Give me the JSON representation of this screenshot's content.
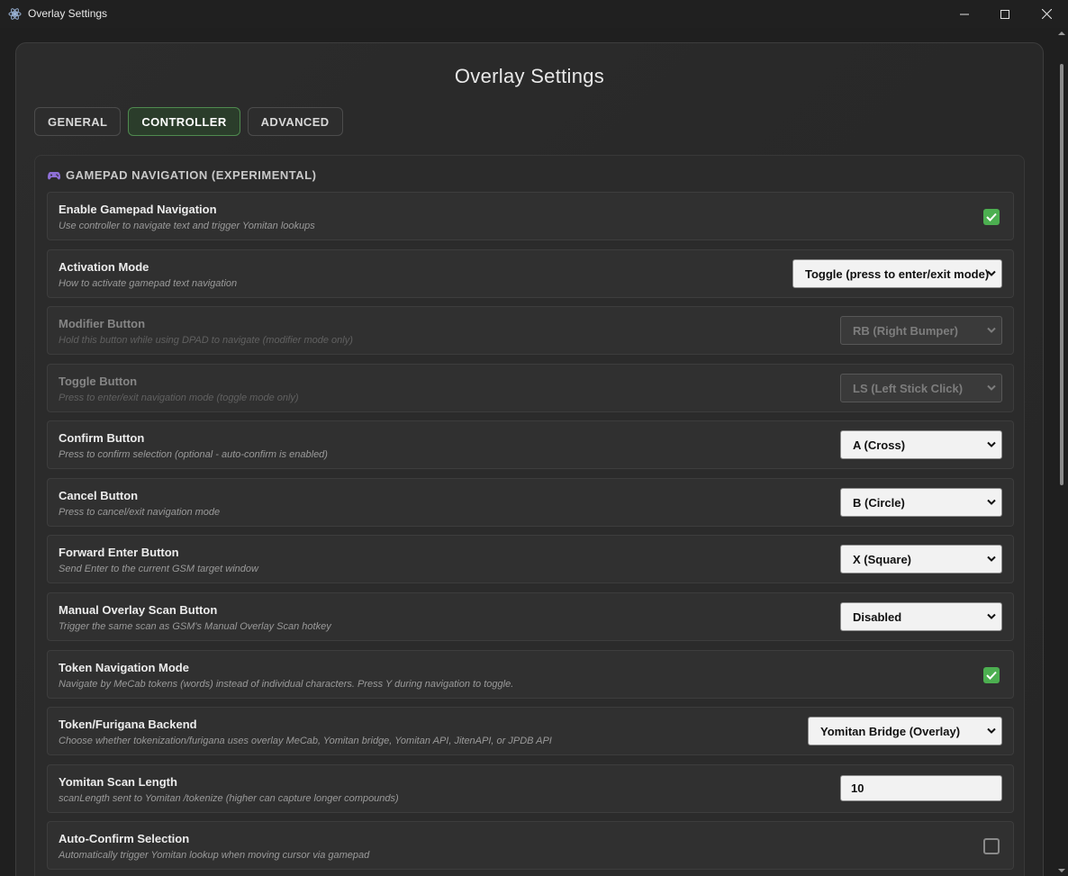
{
  "window": {
    "title": "Overlay Settings"
  },
  "page": {
    "title": "Overlay Settings"
  },
  "tabs": [
    {
      "label": "GENERAL",
      "active": false
    },
    {
      "label": "CONTROLLER",
      "active": true
    },
    {
      "label": "ADVANCED",
      "active": false
    }
  ],
  "section": {
    "icon": "gamepad-icon",
    "title": "GAMEPAD NAVIGATION (EXPERIMENTAL)"
  },
  "settings": {
    "enable_gamepad": {
      "label": "Enable Gamepad Navigation",
      "desc": "Use controller to navigate text and trigger Yomitan lookups",
      "checked": true
    },
    "activation_mode": {
      "label": "Activation Mode",
      "desc": "How to activate gamepad text navigation",
      "value": "Toggle (press to enter/exit mode)"
    },
    "modifier_button": {
      "label": "Modifier Button",
      "desc": "Hold this button while using DPAD to navigate (modifier mode only)",
      "value": "RB (Right Bumper)",
      "disabled": true
    },
    "toggle_button": {
      "label": "Toggle Button",
      "desc": "Press to enter/exit navigation mode (toggle mode only)",
      "value": "LS (Left Stick Click)",
      "disabled": true
    },
    "confirm_button": {
      "label": "Confirm Button",
      "desc": "Press to confirm selection (optional - auto-confirm is enabled)",
      "value": "A (Cross)"
    },
    "cancel_button": {
      "label": "Cancel Button",
      "desc": "Press to cancel/exit navigation mode",
      "value": "B (Circle)"
    },
    "forward_enter": {
      "label": "Forward Enter Button",
      "desc": "Send Enter to the current GSM target window",
      "value": "X (Square)"
    },
    "manual_scan": {
      "label": "Manual Overlay Scan Button",
      "desc": "Trigger the same scan as GSM's Manual Overlay Scan hotkey",
      "value": "Disabled"
    },
    "token_nav": {
      "label": "Token Navigation Mode",
      "desc": "Navigate by MeCab tokens (words) instead of individual characters. Press Y during navigation to toggle.",
      "checked": true
    },
    "token_backend": {
      "label": "Token/Furigana Backend",
      "desc": "Choose whether tokenization/furigana uses overlay MeCab, Yomitan bridge, Yomitan API, JitenAPI, or JPDB API",
      "value": "Yomitan Bridge (Overlay)"
    },
    "scan_length": {
      "label": "Yomitan Scan Length",
      "desc": "scanLength sent to Yomitan /tokenize (higher can capture longer compounds)",
      "value": "10"
    },
    "auto_confirm": {
      "label": "Auto-Confirm Selection",
      "desc": "Automatically trigger Yomitan lookup when moving cursor via gamepad",
      "checked": false
    }
  },
  "colors": {
    "accent": "#4caf50",
    "active_tab_border": "#4f8a4f"
  }
}
